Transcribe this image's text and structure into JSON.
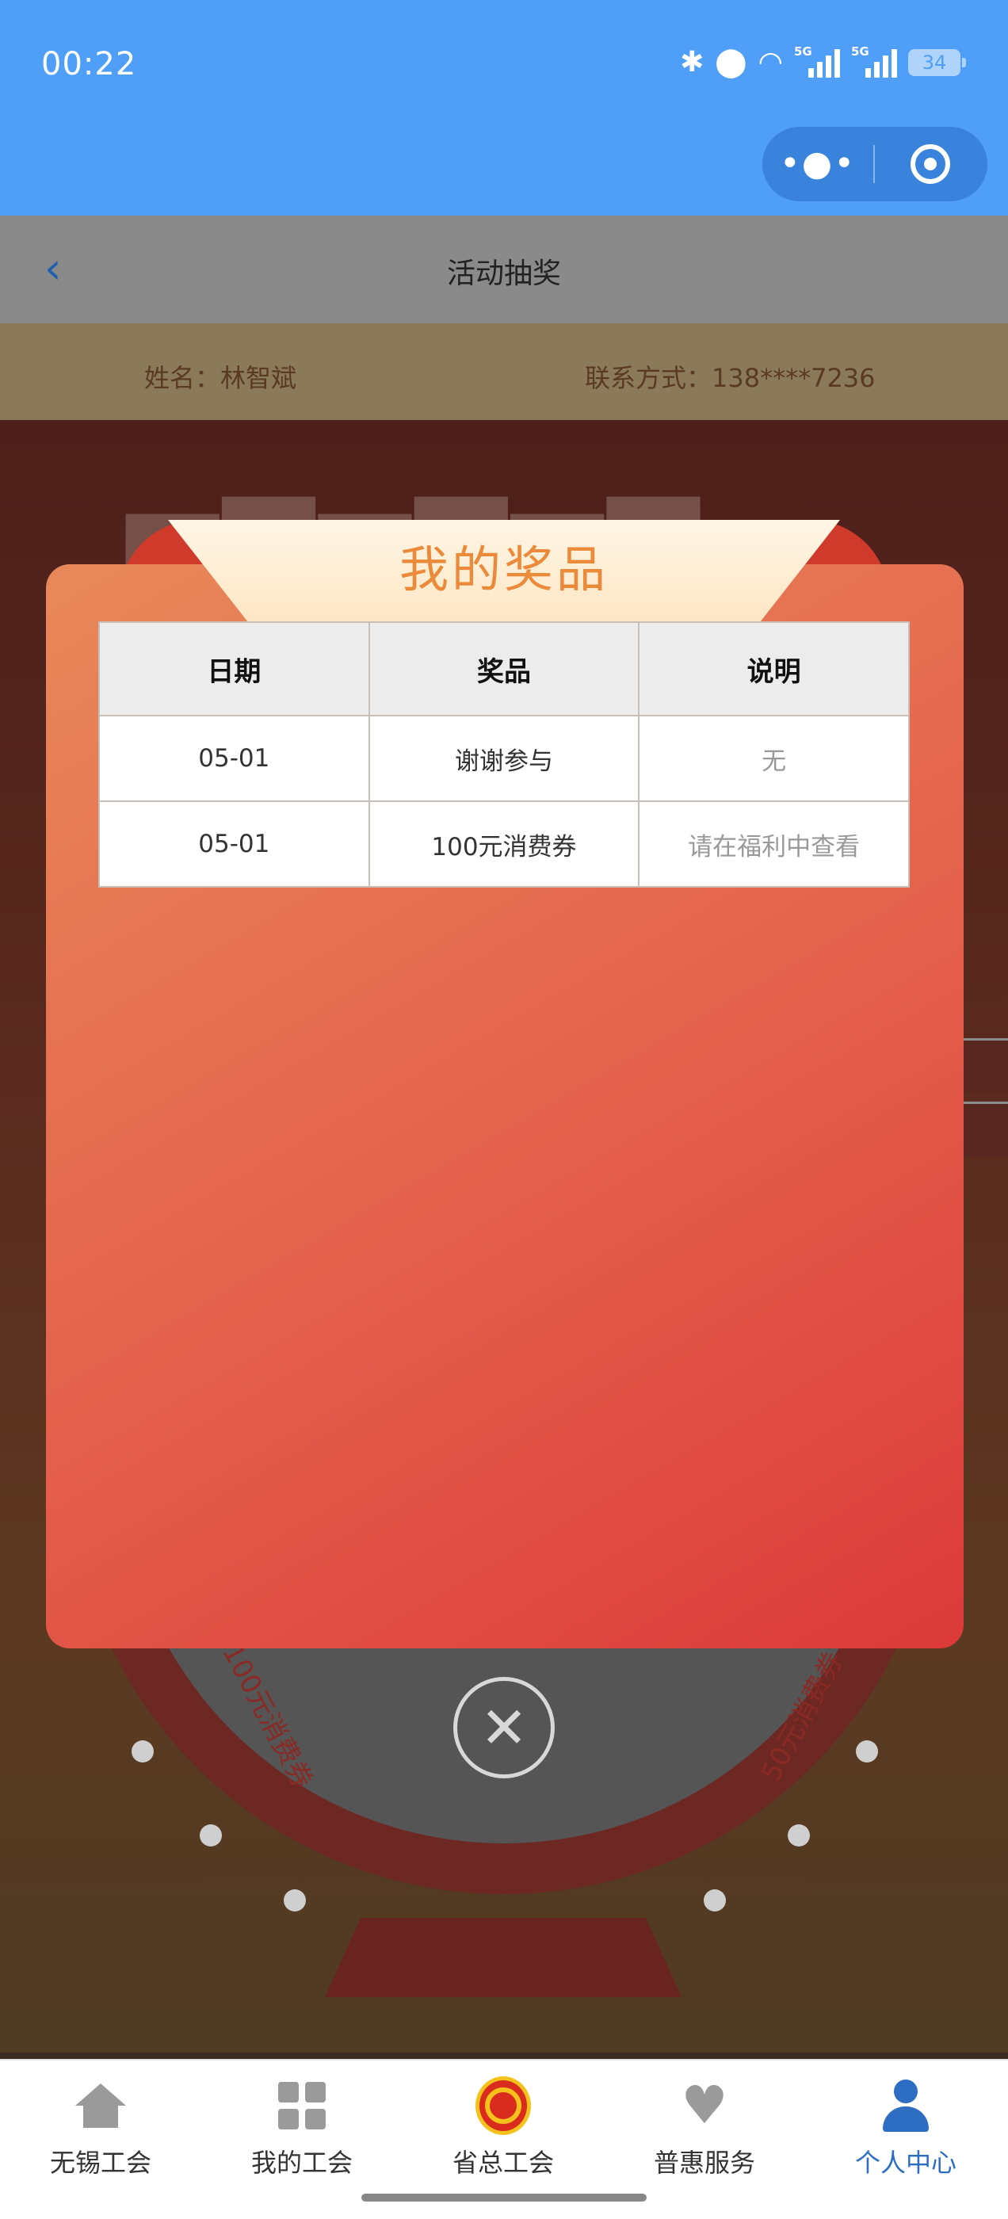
{
  "status_bar": {
    "time": "00:22",
    "battery": "34",
    "network": "5G"
  },
  "capsule": {
    "more_icon": "more-dots-icon",
    "close_icon": "target-icon"
  },
  "nav": {
    "title": "活动抽奖",
    "back_icon": "back-chevron-icon"
  },
  "user_info": {
    "name": "姓名：林智斌",
    "phone": "联系方式：138****7236"
  },
  "background": {
    "wheel_labels": [
      "100元消费券",
      "50元消费券"
    ]
  },
  "modal": {
    "title": "我的奖品",
    "columns": [
      "日期",
      "奖品",
      "说明"
    ],
    "rows": [
      {
        "date": "05-01",
        "prize": "谢谢参与",
        "note": "无"
      },
      {
        "date": "05-01",
        "prize": "100元消费券",
        "note": "请在福利中查看"
      }
    ],
    "close_icon": "close-circle-icon"
  },
  "tabbar": {
    "items": [
      {
        "label": "无锡工会",
        "icon": "home-icon"
      },
      {
        "label": "我的工会",
        "icon": "grid-icon"
      },
      {
        "label": "省总工会",
        "icon": "union-logo-icon"
      },
      {
        "label": "普惠服务",
        "icon": "heart-icon"
      },
      {
        "label": "个人中心",
        "icon": "user-icon",
        "active": true
      }
    ]
  },
  "colors": {
    "status_bar": "#4f9ef7",
    "modal_gradient_start": "#e8895a",
    "modal_gradient_end": "#dc3a3a",
    "title_orange": "#ea8a3a",
    "active_tab": "#2e6ec2"
  }
}
